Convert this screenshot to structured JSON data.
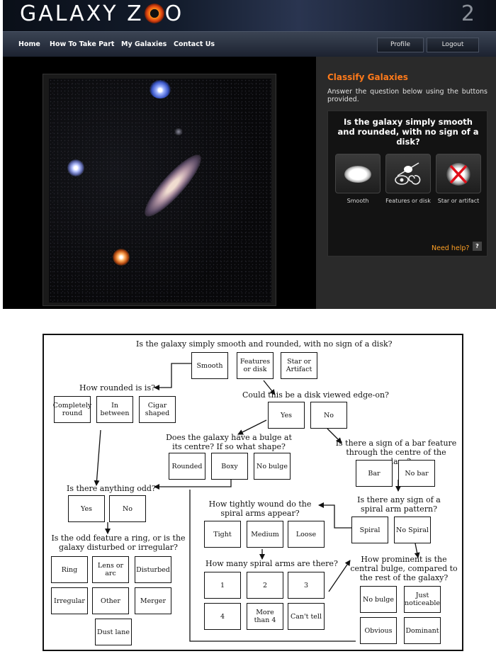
{
  "header": {
    "logo": [
      "GALAXY Z",
      "O"
    ],
    "version": "2"
  },
  "nav": {
    "links": [
      "Home",
      "How To Take Part",
      "My Galaxies",
      "Contact Us"
    ],
    "buttons": [
      "Profile",
      "Logout"
    ]
  },
  "panel": {
    "title": "Classify Galaxies",
    "instructions": "Answer the question below using the buttons provided.",
    "question": "Is the galaxy simply smooth and rounded, with no sign of a disk?",
    "choices": [
      "Smooth",
      "Features or disk",
      "Star or artifact"
    ],
    "help": "Need help?",
    "help_icon": "?"
  },
  "flow": {
    "q1": "Is the galaxy simply smooth and rounded, with no sign of a disk?",
    "q1_opts": [
      "Smooth",
      "Features or disk",
      "Star or Artifact"
    ],
    "q_rounded": "How rounded is is?",
    "rounded_opts": [
      "Completely round",
      "In between",
      "Cigar shaped"
    ],
    "q_edge": "Could this be a disk viewed edge-on?",
    "edge_opts": [
      "Yes",
      "No"
    ],
    "q_bulge": "Does the galaxy have a bulge at its centre? If so what shape?",
    "bulge_opts": [
      "Rounded",
      "Boxy",
      "No bulge"
    ],
    "q_bar": "Is there a sign of a bar feature through the centre of the galaxy?",
    "bar_opts": [
      "Bar",
      "No bar"
    ],
    "q_odd": "Is there anything odd?",
    "odd_opts": [
      "Yes",
      "No"
    ],
    "q_spiral": "Is there any sign of a spiral arm pattern?",
    "spiral_opts": [
      "Spiral",
      "No Spiral"
    ],
    "q_wound": "How tightly wound do the spiral arms appear?",
    "wound_opts": [
      "Tight",
      "Medium",
      "Loose"
    ],
    "q_arms": "How many spiral arms are there?",
    "arms_opts": [
      "1",
      "2",
      "3",
      "4",
      "More than 4",
      "Can't tell"
    ],
    "q_prom": "How prominent is the central bulge, compared to the rest of the galaxy?",
    "prom_opts": [
      "No bulge",
      "Just noticeable",
      "Obvious",
      "Dominant"
    ],
    "q_ring": "Is the odd feature a ring, or is the galaxy disturbed or irregular?",
    "ring_opts": [
      "Ring",
      "Lens or arc",
      "Disturbed",
      "Irregular",
      "Other",
      "Merger",
      "Dust lane"
    ]
  }
}
